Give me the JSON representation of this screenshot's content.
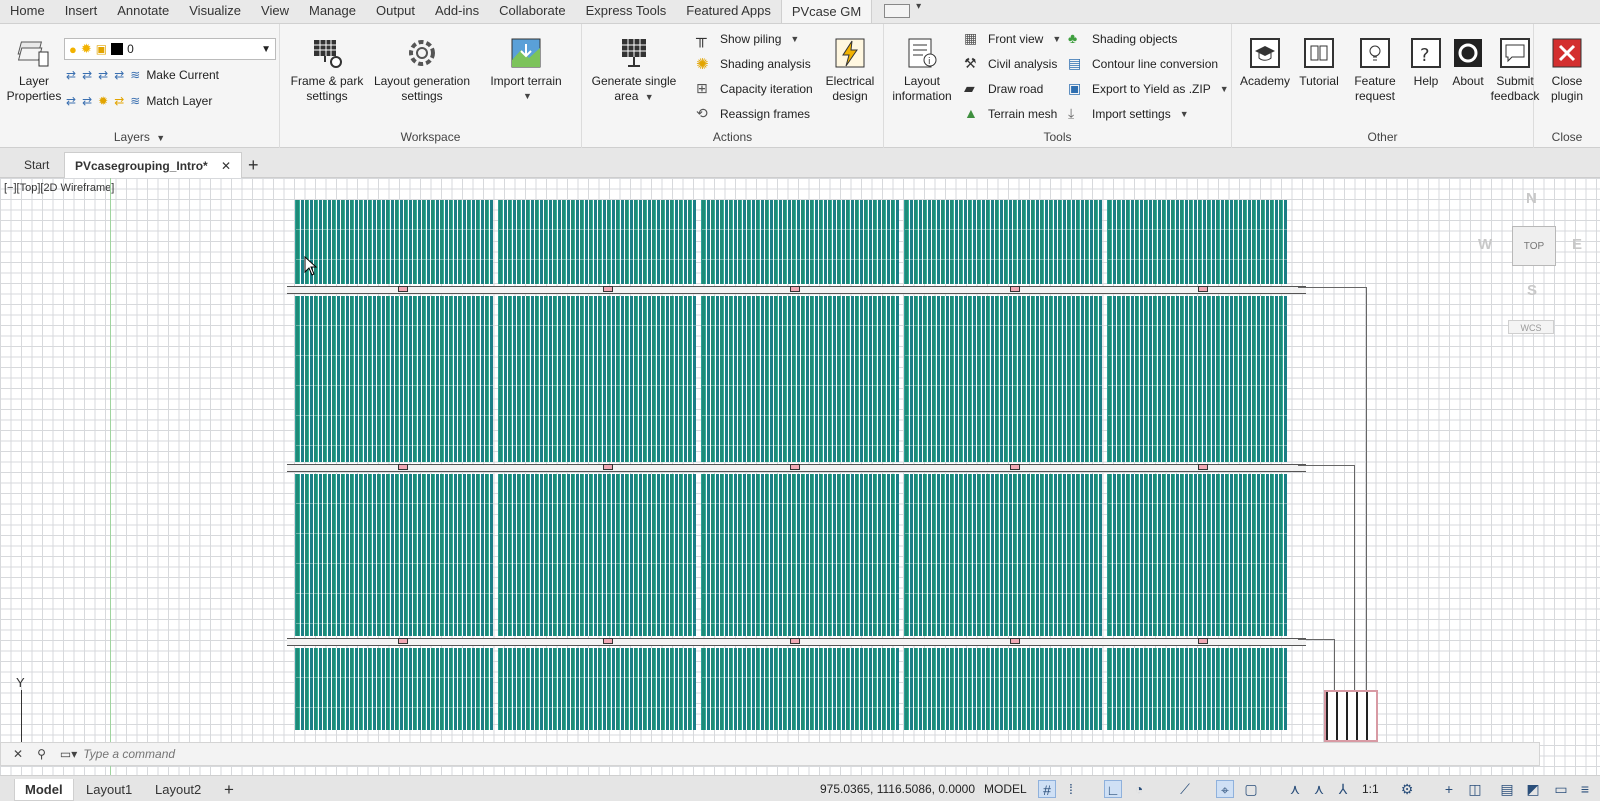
{
  "menu": {
    "tabs": [
      "Home",
      "Insert",
      "Annotate",
      "Visualize",
      "View",
      "Manage",
      "Output",
      "Add-ins",
      "Collaborate",
      "Express Tools",
      "Featured Apps",
      "PVcase GM"
    ],
    "active": "PVcase GM"
  },
  "ribbon": {
    "layers": {
      "title": "Layers",
      "layer_properties": "Layer Properties",
      "current_layer": "0",
      "make_current": "Make Current",
      "match_layer": "Match Layer"
    },
    "workspace": {
      "title": "Workspace",
      "frame_park": "Frame & park settings",
      "layout_generation": "Layout generation settings",
      "import_terrain": "Import terrain"
    },
    "actions": {
      "title": "Actions",
      "generate_single_area": "Generate single area",
      "show_piling": "Show piling",
      "shading_analysis": "Shading analysis",
      "capacity_iteration": "Capacity iteration",
      "reassign_frames": "Reassign frames",
      "electrical_design": "Electrical design"
    },
    "tools": {
      "title": "Tools",
      "layout_information": "Layout information",
      "front_view": "Front view",
      "civil_analysis": "Civil analysis",
      "draw_road": "Draw road",
      "terrain_mesh": "Terrain mesh",
      "shading_objects": "Shading objects",
      "contour_line_conversion": "Contour line conversion",
      "export_yield": "Export to Yield as .ZIP",
      "import_settings": "Import settings"
    },
    "other": {
      "title": "Other",
      "academy": "Academy",
      "tutorial": "Tutorial",
      "feature_request": "Feature request",
      "help": "Help",
      "about": "About",
      "submit_feedback": "Submit feedback"
    },
    "close": {
      "title": "Close",
      "close_plugin": "Close plugin"
    }
  },
  "doc_tabs": {
    "start": "Start",
    "active": "PVcasegrouping_Intro*"
  },
  "viewport": {
    "label": "[−][Top][2D Wireframe]",
    "compass_n": "N",
    "compass_s": "S",
    "compass_e": "E",
    "compass_w": "W",
    "cube_face": "TOP",
    "wcs": "WCS",
    "ucs_y": "Y"
  },
  "command": {
    "placeholder": "Type a command"
  },
  "status": {
    "layout_tabs": [
      "Model",
      "Layout1",
      "Layout2"
    ],
    "coordinates": "975.0365, 1116.5086, 0.0000",
    "mode": "MODEL",
    "scale": "1:1"
  },
  "colors": {
    "panel_fill": "#1f8a78",
    "inverter": "#f1a9b5",
    "close_red": "#d32f2f"
  }
}
